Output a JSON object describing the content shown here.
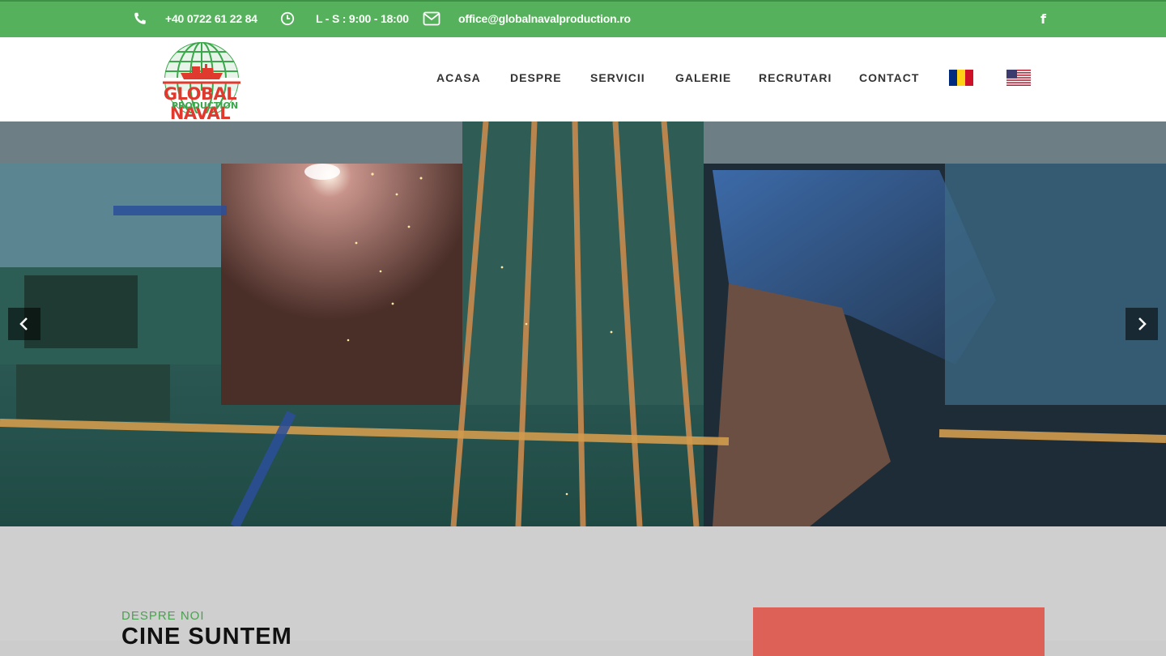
{
  "topbar": {
    "phone": "+40 0722 61 22 84",
    "hours": "L - S : 9:00 - 18:00",
    "email": "office@globalnavalproduction.ro",
    "facebook_glyph": "f",
    "icons": [
      "phone-icon",
      "clock-icon",
      "envelope-icon",
      "facebook-icon"
    ]
  },
  "logo": {
    "line1": "GLOBAL NAVAL",
    "line2": "PRODUCTION"
  },
  "nav": {
    "items": [
      "ACASA",
      "DESPRE",
      "SERVICII",
      "GALERIE",
      "RECRUTARI",
      "CONTACT"
    ],
    "flags": [
      "romania-flag",
      "usa-flag"
    ]
  },
  "hero": {
    "icons": [
      "chevron-left-icon",
      "chevron-right-icon"
    ]
  },
  "about": {
    "eyebrow": "DESPRE NOI",
    "title": "CINE SUNTEM"
  },
  "colors": {
    "brand_green": "#55b15b",
    "accent_red": "#dd6156",
    "logo_red": "#e03a2f"
  }
}
